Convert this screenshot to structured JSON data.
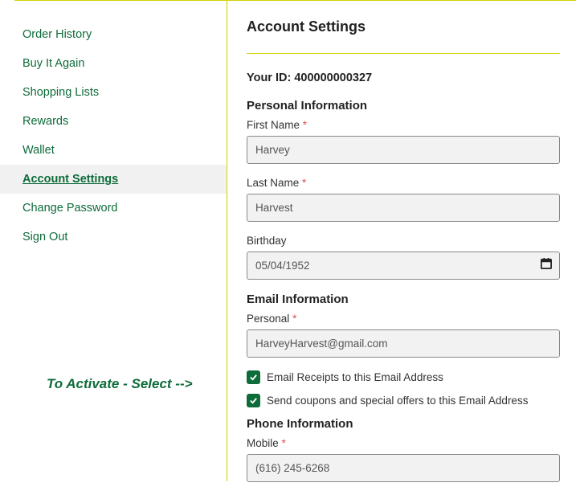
{
  "sidebar": {
    "items": [
      {
        "label": "Order History"
      },
      {
        "label": "Buy It Again"
      },
      {
        "label": "Shopping Lists"
      },
      {
        "label": "Rewards"
      },
      {
        "label": "Wallet"
      },
      {
        "label": "Account Settings"
      },
      {
        "label": "Change Password"
      },
      {
        "label": "Sign Out"
      }
    ]
  },
  "annotation": "To Activate - Select -->",
  "page": {
    "title": "Account Settings",
    "your_id_label": "Your ID:",
    "your_id_value": "400000000327"
  },
  "personal": {
    "section": "Personal Information",
    "first_name_label": "First Name",
    "first_name_value": "Harvey",
    "last_name_label": "Last Name",
    "last_name_value": "Harvest",
    "birthday_label": "Birthday",
    "birthday_value": "05/04/1952"
  },
  "email": {
    "section": "Email Information",
    "personal_label": "Personal",
    "personal_value": "HarveyHarvest@gmail.com",
    "receipts_label": "Email Receipts to this Email Address",
    "coupons_label": "Send coupons and special offers to this Email Address"
  },
  "phone": {
    "section": "Phone Information",
    "mobile_label": "Mobile",
    "mobile_value": "(616) 245-6268"
  },
  "asterisk": "*"
}
